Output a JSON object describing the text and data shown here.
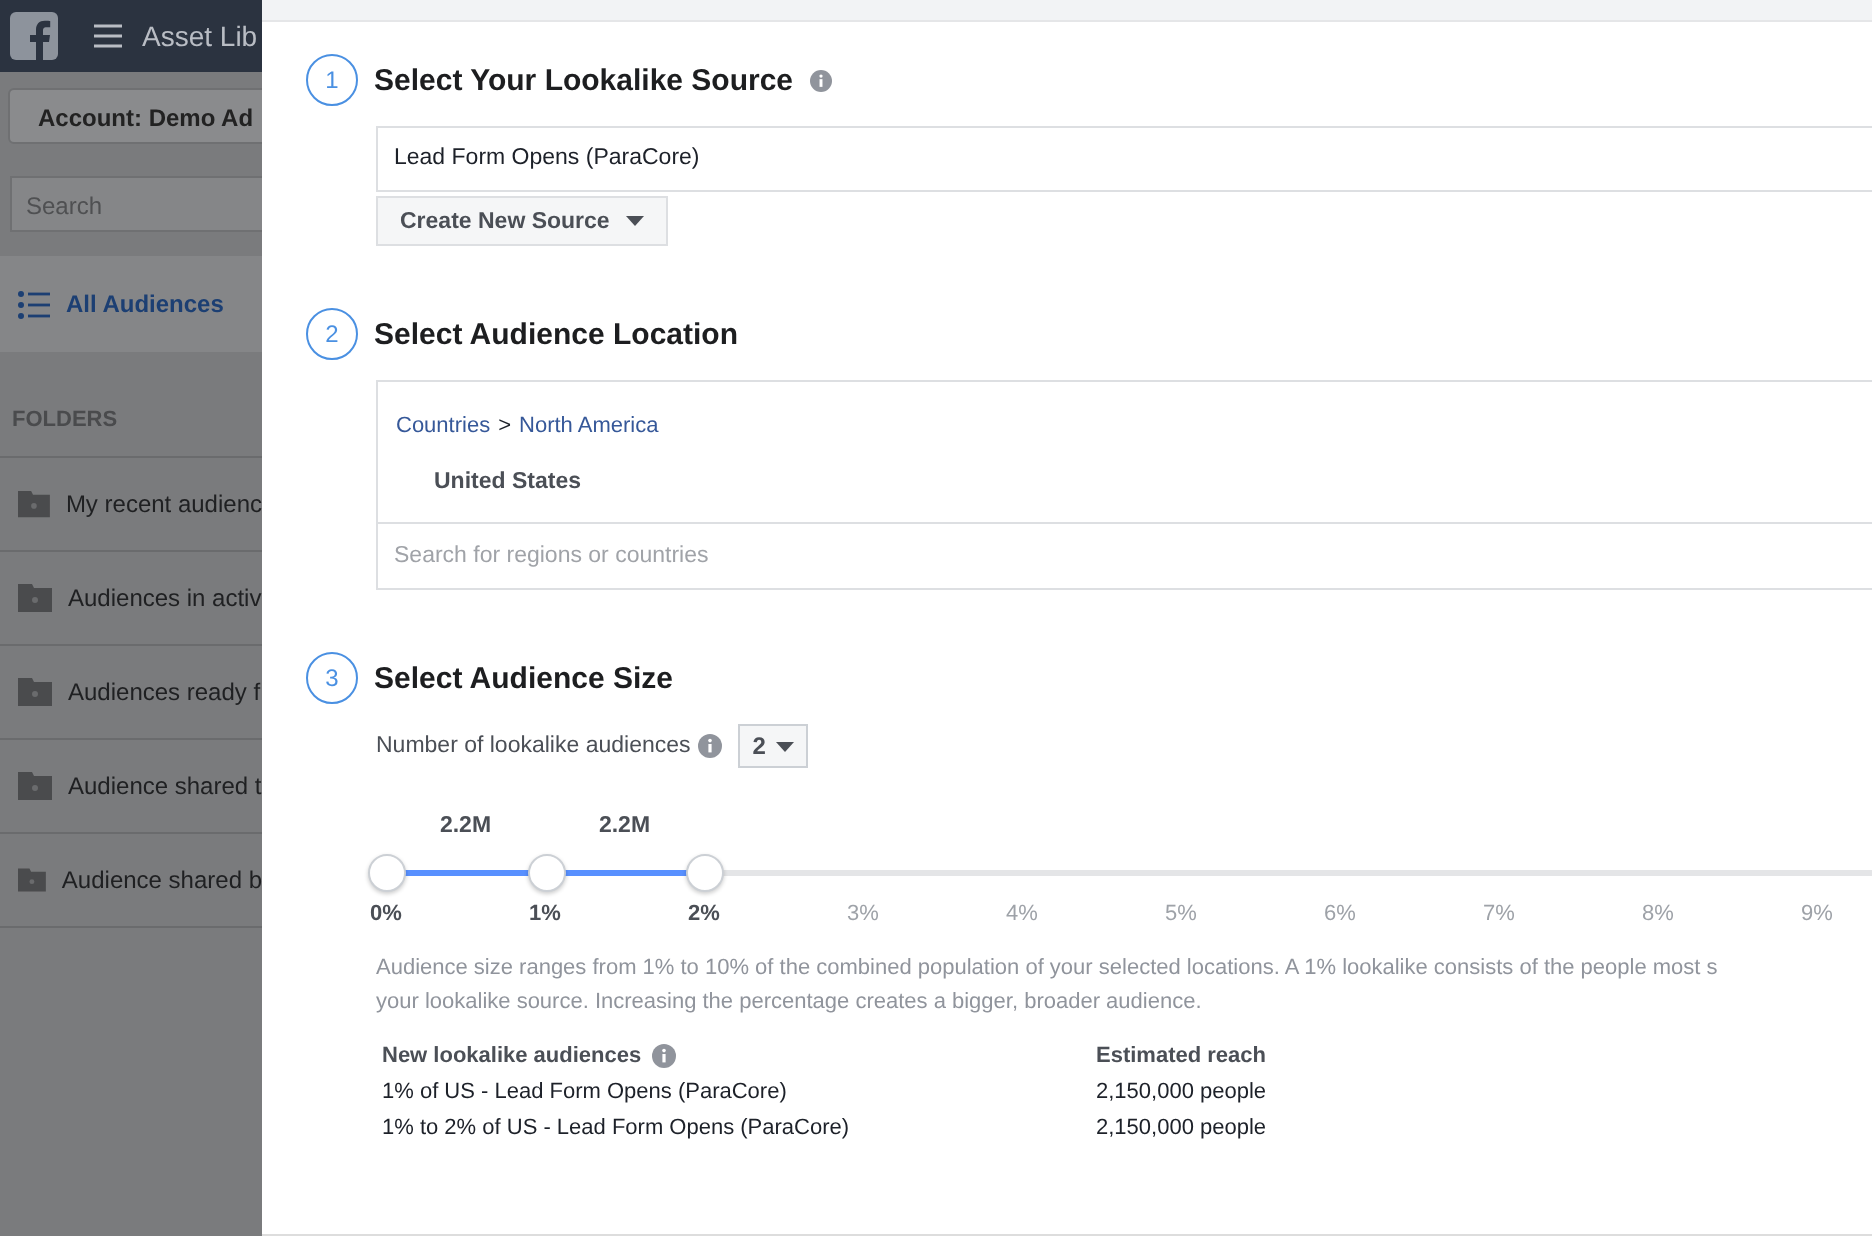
{
  "topbar": {
    "title": "Asset Lib"
  },
  "sidebar": {
    "account": "Account: Demo Ad",
    "search_placeholder": "Search",
    "all_audiences": "All Audiences",
    "folders_heading": "FOLDERS",
    "folders": [
      "My recent audienc",
      "Audiences in activ",
      "Audiences ready f",
      "Audience shared t",
      "Audience shared b"
    ]
  },
  "steps": [
    {
      "number": "1",
      "title": "Select Your Lookalike Source",
      "source": "Lead Form Opens (ParaCore)",
      "create_button": "Create New Source"
    },
    {
      "number": "2",
      "title": "Select Audience Location",
      "breadcrumb": [
        "Countries",
        "North America"
      ],
      "separator": ">",
      "location": "United States",
      "search_placeholder": "Search for regions or countries"
    },
    {
      "number": "3",
      "title": "Select Audience Size",
      "count_label": "Number of lookalike audiences",
      "count_value": "2",
      "slider": {
        "thumbs": [
          {
            "level": 0
          },
          {
            "level": 0.1
          },
          {
            "level": 0.2
          }
        ],
        "segment_labels": [
          "2.2M",
          "2.2M"
        ],
        "ticks": [
          {
            "label": "0%",
            "selected": true
          },
          {
            "label": "1%",
            "selected": true
          },
          {
            "label": "2%",
            "selected": true
          },
          {
            "label": "3%",
            "selected": false
          },
          {
            "label": "4%",
            "selected": false
          },
          {
            "label": "5%",
            "selected": false
          },
          {
            "label": "6%",
            "selected": false
          },
          {
            "label": "7%",
            "selected": false
          },
          {
            "label": "8%",
            "selected": false
          },
          {
            "label": "9%",
            "selected": false
          }
        ]
      },
      "description": "Audience size ranges from 1% to 10% of the combined population of your selected locations. A 1% lookalike consists of the people most s your lookalike source. Increasing the percentage creates a bigger, broader audience.",
      "table": {
        "columns": [
          "New lookalike audiences",
          "Estimated reach"
        ],
        "rows": [
          [
            "1% of US - Lead Form Opens (ParaCore)",
            "2,150,000 people"
          ],
          [
            "1% to 2% of US - Lead Form Opens (ParaCore)",
            "2,150,000 people"
          ]
        ]
      }
    }
  ]
}
